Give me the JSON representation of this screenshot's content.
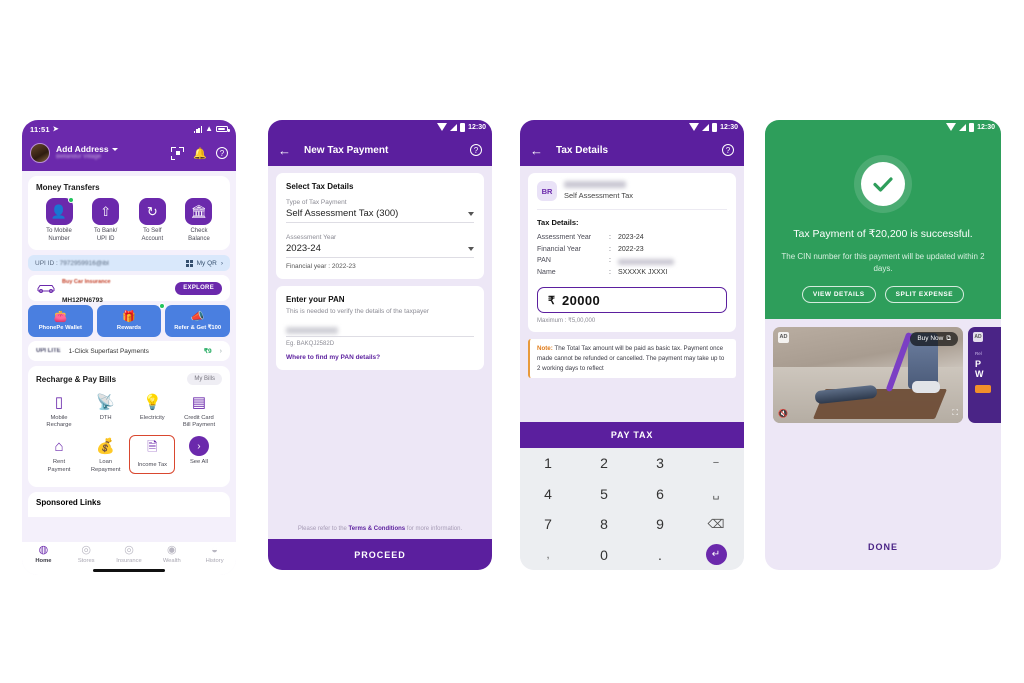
{
  "phone1": {
    "status": {
      "time": "11:51",
      "location_icon": "navigation-icon"
    },
    "header": {
      "address_label": "Add Address",
      "address_sub": "Bellandur Village",
      "scan_icon": "scan-qr-icon",
      "bell_icon": "bell-icon",
      "help_icon": "help-circle-icon"
    },
    "money_transfers": {
      "title": "Money Transfers",
      "items": [
        {
          "label": "To Mobile\nNumber",
          "label1": "To Mobile",
          "label2": "Number",
          "icon": "person-icon",
          "badge": true
        },
        {
          "label1": "To Bank/",
          "label2": "UPI ID",
          "icon": "bank-arrow-icon",
          "badge": false
        },
        {
          "label1": "To Self",
          "label2": "Account",
          "icon": "refresh-clock-icon",
          "badge": false
        },
        {
          "label1": "Check",
          "label2": "Balance",
          "icon": "bank-icon",
          "badge": false
        }
      ]
    },
    "upi_row": {
      "prefix": "UPI ID :",
      "value": "7972959916@ibl",
      "my_qr": "My QR",
      "grid_icon": "qr-grid-icon",
      "chevron": "›"
    },
    "insurance": {
      "title": "Buy Car Insurance",
      "plate": "MH12PN6793",
      "cta": "EXPLORE",
      "icon": "car-icon"
    },
    "blue_cards": [
      {
        "label": "PhonePe Wallet",
        "icon": "wallet-icon",
        "badge": false
      },
      {
        "label": "Rewards",
        "icon": "gift-icon",
        "badge": true
      },
      {
        "label": "Refer & Get ₹100",
        "icon": "megaphone-icon",
        "badge": false
      }
    ],
    "lite": {
      "logo": "UPI LITE",
      "text": "1-Click Superfast Payments",
      "amount": "₹9",
      "chevron": "›"
    },
    "recharge": {
      "title": "Recharge & Pay Bills",
      "my_bills": "My Bills",
      "items": [
        {
          "label1": "Mobile",
          "label2": "Recharge",
          "icon": "mobile-recharge-icon",
          "highlight": false
        },
        {
          "label1": "DTH",
          "label2": "",
          "icon": "dth-dish-icon",
          "highlight": false
        },
        {
          "label1": "Electricity",
          "label2": "",
          "icon": "bulb-icon",
          "highlight": false
        },
        {
          "label1": "Credit Card",
          "label2": "Bill Payment",
          "icon": "credit-card-icon",
          "highlight": false
        },
        {
          "label1": "Rent",
          "label2": "Payment",
          "icon": "house-clock-icon",
          "highlight": false
        },
        {
          "label1": "Loan",
          "label2": "Repayment",
          "icon": "money-bag-icon",
          "highlight": false
        },
        {
          "label1": "Income Tax",
          "label2": "",
          "icon": "tax-doc-icon",
          "highlight": true
        },
        {
          "label1": "See All",
          "label2": "",
          "icon": "chevron-right-circle-icon",
          "highlight": false
        }
      ]
    },
    "sponsored_title": "Sponsored Links",
    "tabs": [
      {
        "label": "Home",
        "icon": "home-icon",
        "active": true
      },
      {
        "label": "Stores",
        "icon": "store-icon",
        "active": false
      },
      {
        "label": "Insurance",
        "icon": "shield-icon",
        "active": false
      },
      {
        "label": "Wealth",
        "icon": "coin-icon",
        "active": false
      },
      {
        "label": "History",
        "icon": "history-icon",
        "active": false
      }
    ]
  },
  "phone2": {
    "status": {
      "time": "12:30"
    },
    "title": "New Tax Payment",
    "back_icon": "back-arrow-icon",
    "help_icon": "help-circle-icon",
    "section_title": "Select Tax Details",
    "fields": [
      {
        "label": "Type of Tax Payment",
        "value": "Self Assessment Tax (300)"
      },
      {
        "label": "Assessment Year",
        "value": "2023-24"
      }
    ],
    "financial_year_note": "Financial year : 2022-23",
    "pan": {
      "title": "Enter your PAN",
      "subtitle": "This is needed to verify the details of the taxpayer",
      "value": "",
      "example": "Eg. BAKQJ2582D",
      "link": "Where to find my PAN details?"
    },
    "tnc_pre": "Please refer to the ",
    "tnc_link": "Terms & Conditions",
    "tnc_post": " for more information.",
    "proceed": "PROCEED"
  },
  "phone3": {
    "status": {
      "time": "12:30"
    },
    "title": "Tax Details",
    "back_icon": "back-arrow-icon",
    "help_icon": "help-circle-icon",
    "avatar_initials": "BR",
    "payee_name": "",
    "payee_type": "Self Assessment Tax",
    "details_title": "Tax Details:",
    "details": [
      {
        "key": "Assessment Year",
        "sep": ":",
        "value": "2023-24",
        "blurred": false
      },
      {
        "key": "Financial Year",
        "sep": ":",
        "value": "2022-23",
        "blurred": false
      },
      {
        "key": "PAN",
        "sep": ":",
        "value": "",
        "blurred": true
      },
      {
        "key": "Name",
        "sep": ":",
        "value": "SXXXXK JXXXI",
        "blurred": false
      }
    ],
    "amount": {
      "currency": "₹",
      "value": "20000",
      "maximum": "Maximum : ₹5,00,000"
    },
    "note_label": "Note:",
    "note_text": " The Total Tax amount will be paid as basic tax. Payment once made cannot be refunded or cancelled. The payment may take up to 2 working days to reflect",
    "pay_button": "PAY TAX",
    "keypad": [
      "1",
      "2",
      "3",
      "−",
      "4",
      "5",
      "6",
      "␣",
      "7",
      "8",
      "9",
      "⌫",
      ",",
      "0",
      ".",
      "↵"
    ]
  },
  "phone4": {
    "status": {
      "time": "12:30"
    },
    "check_icon": "check-circle-icon",
    "success_title": "Tax Payment of ₹20,200 is successful.",
    "success_sub": "The CIN number for this payment will be updated within 2 days.",
    "buttons": [
      {
        "label": "VIEW DETAILS"
      },
      {
        "label": "SPLIT EXPENSE"
      }
    ],
    "ad1": {
      "badge": "AD",
      "cta": "Buy Now",
      "external_icon": "external-link-icon",
      "mute_icon": "mute-icon",
      "expand_icon": "expand-icon"
    },
    "ad2": {
      "badge": "AD",
      "line1": "Rel",
      "line2a": "P",
      "line2b": "W"
    },
    "done": "DONE"
  },
  "colors": {
    "phonepe_purple": "#6b29ac",
    "android_purple": "#5b1f9e",
    "success_green": "#2e9e5b",
    "blue_card": "#4a7fe0",
    "highlight_red": "#d9472f",
    "page_bg": "#ede7f6"
  }
}
